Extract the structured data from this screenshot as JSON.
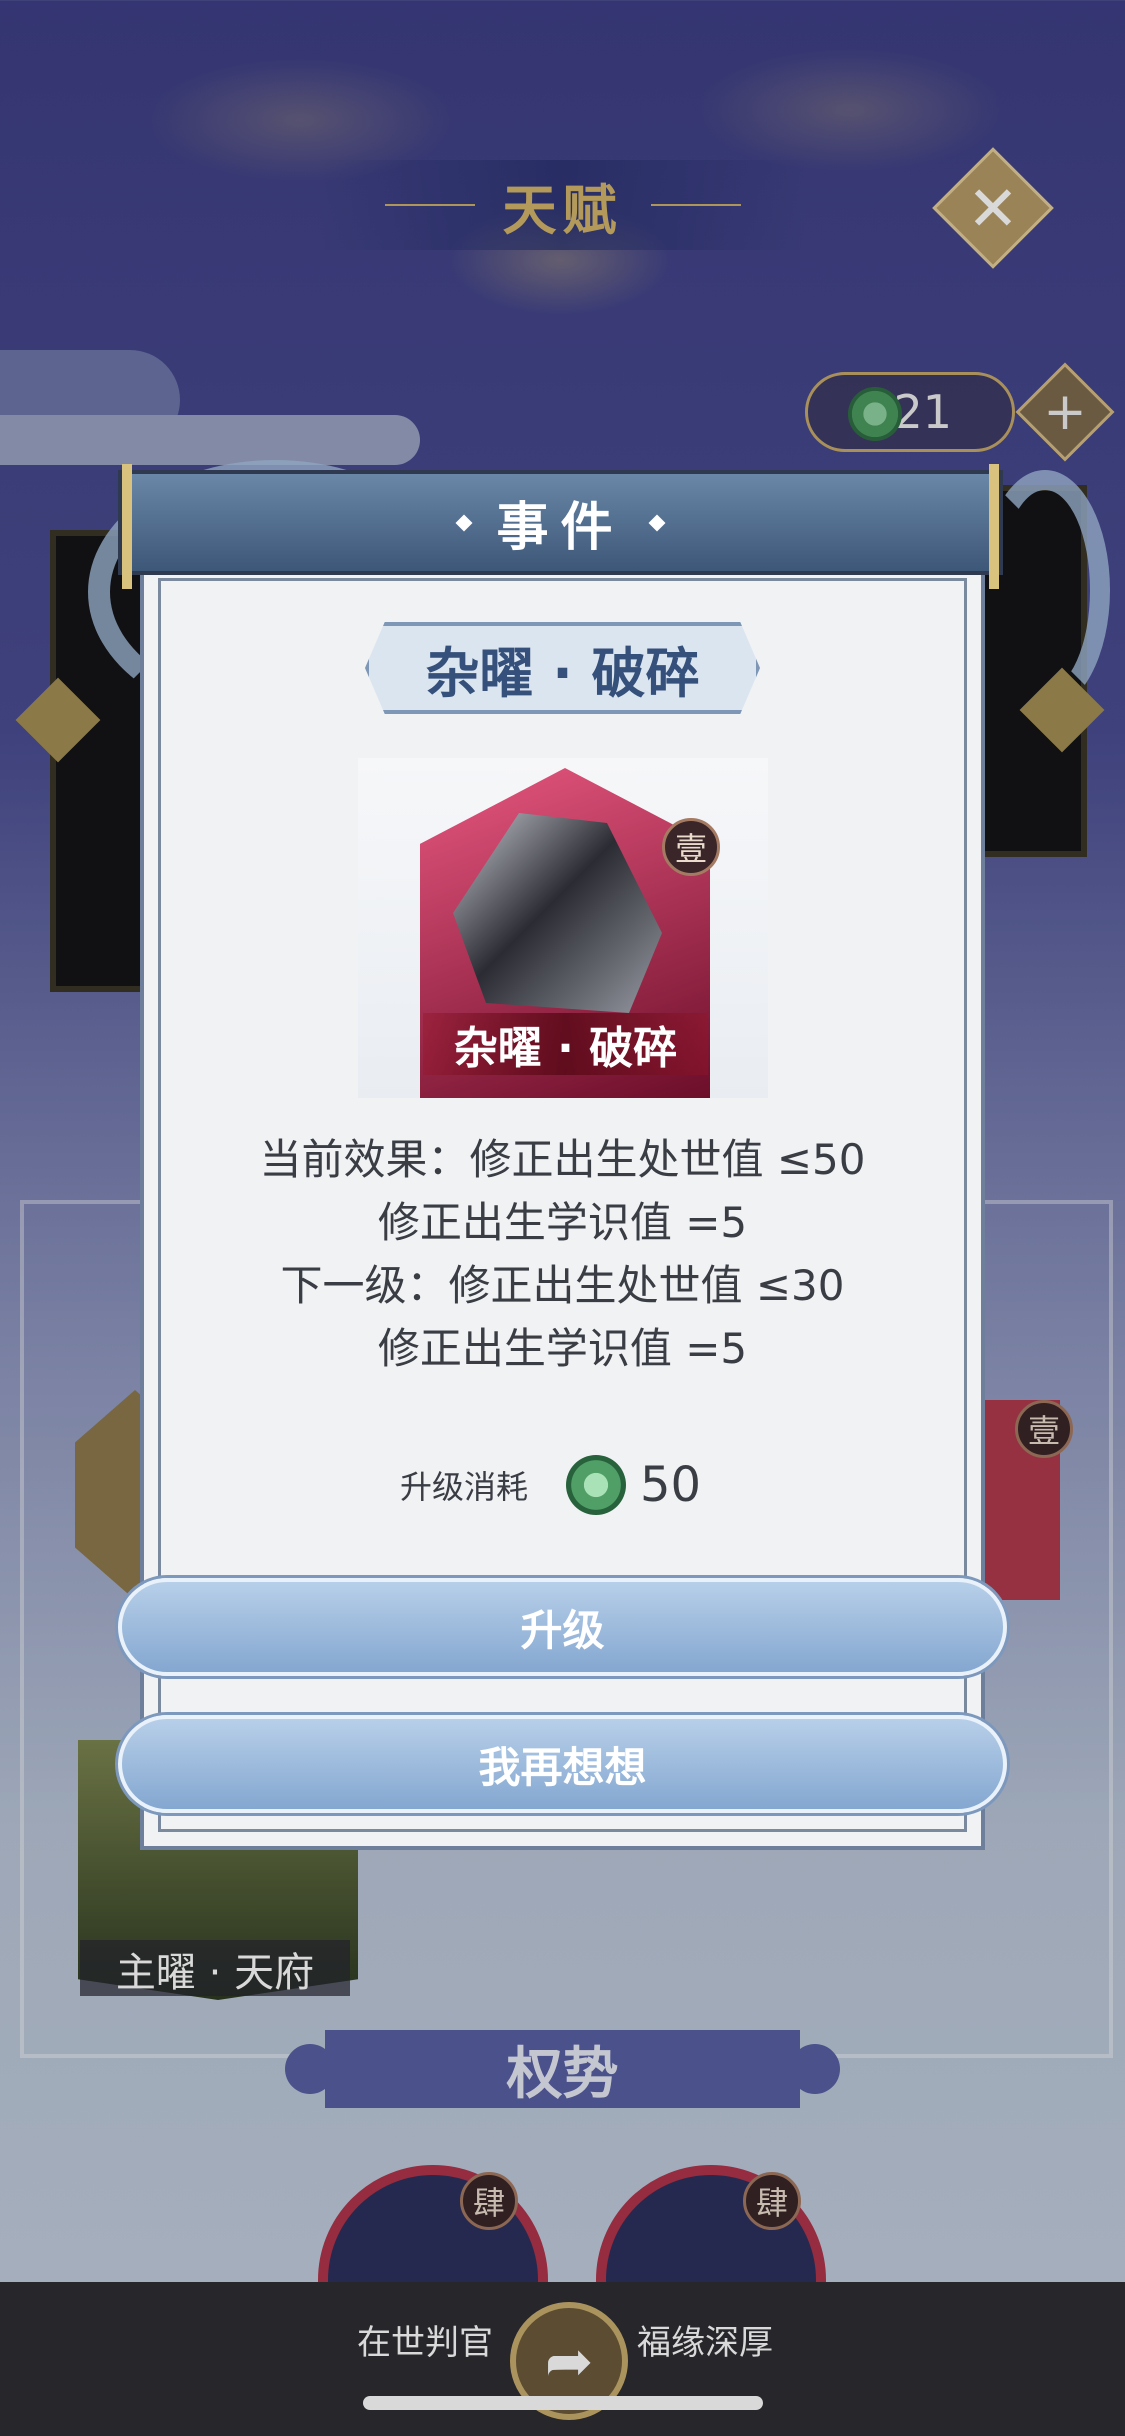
{
  "background": {
    "title": "天赋",
    "close_glyph": "✕",
    "currency_amount": "321",
    "currency_plus": "+",
    "left_badge": "壹",
    "green_card_label": "主曜 · 天府",
    "section_title": "权势",
    "skills": [
      {
        "label": "在世判官",
        "badge": "肆"
      },
      {
        "label": "福缘深厚",
        "badge": "肆"
      }
    ],
    "share_icon": "share-icon"
  },
  "modal": {
    "header": "事件",
    "name": "杂曜 · 破碎",
    "art_badge": "壹",
    "art_caption": "杂曜 · 破碎",
    "effects": [
      "当前效果：修正出生处世值 ≤50",
      "修正出生学识值 =5",
      "下一级：修正出生处世值 ≤30",
      "修正出生学识值 =5"
    ],
    "cost_label": "升级消耗",
    "cost_value": "50",
    "upgrade_button": "升级",
    "reconsider_button": "我再想想"
  },
  "colors": {
    "accent_gold": "#d3b56c",
    "modal_blue": "#3d5778",
    "button_blue": "#84a7d0",
    "badge_red": "#b0344a"
  }
}
